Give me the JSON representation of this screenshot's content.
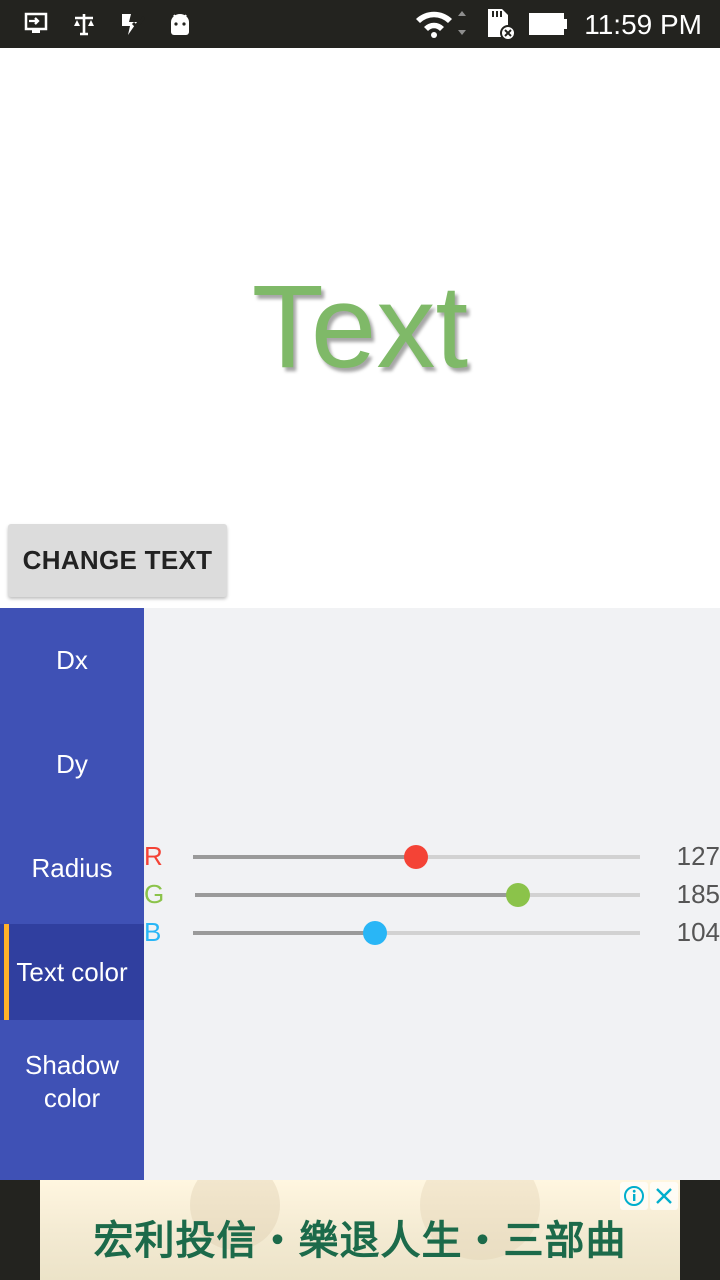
{
  "status_bar": {
    "time": "11:59 PM",
    "icons": [
      "screen-share-icon",
      "scales-icon",
      "check-badge-icon",
      "android-icon",
      "wifi-icon",
      "sd-card-error-icon",
      "battery-icon"
    ]
  },
  "preview": {
    "text": "Text",
    "text_color": "#7fb968"
  },
  "change_button": {
    "label": "CHANGE TEXT"
  },
  "tabs": [
    {
      "label": "Dx",
      "active": false
    },
    {
      "label": "Dy",
      "active": false
    },
    {
      "label": "Radius",
      "active": false
    },
    {
      "label": "Text color",
      "active": true
    },
    {
      "label": "Shadow color",
      "active": false
    }
  ],
  "color_sliders": [
    {
      "channel": "R",
      "value": "127",
      "max": 255,
      "color": "#f44336"
    },
    {
      "channel": "G",
      "value": "185",
      "max": 255,
      "color": "#8bc34a"
    },
    {
      "channel": "B",
      "value": "104",
      "max": 255,
      "color": "#29b6f6"
    }
  ],
  "ad": {
    "text": "宏利投信・樂退人生・三部曲",
    "info_icon": "info-icon",
    "close_icon": "close-icon"
  },
  "colors": {
    "tab_bar": "#3f51b5",
    "tab_active": "#303f9f",
    "tab_indicator": "#ffb12b",
    "panel_bg": "#f1f2f4"
  }
}
